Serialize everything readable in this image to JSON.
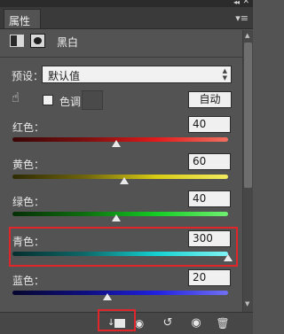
{
  "panel": {
    "tab_label": "属性",
    "collapse_glyph": "◂◂",
    "close_glyph": "✕",
    "menu_glyph": "▾≡"
  },
  "header": {
    "adjustment_title": "黑白",
    "adjustment_icon": "black-white-adjustment-icon",
    "mask_icon": "layer-mask-icon"
  },
  "preset": {
    "label": "预设：",
    "value": "默认值"
  },
  "controls": {
    "tint_label": "色调",
    "tint_checked": false,
    "auto_label": "自动",
    "hand_icon": "targeted-adjustment-hand-icon"
  },
  "sliders": [
    {
      "label": "红色：",
      "value": "40",
      "min": -200,
      "max": 300,
      "colors": [
        "#3a0606",
        "#7a1010",
        "#e11a1a",
        "#f07060"
      ]
    },
    {
      "label": "黄色：",
      "value": "60",
      "min": -200,
      "max": 300,
      "colors": [
        "#2e2a04",
        "#6e640c",
        "#d8cc14",
        "#f2ea60"
      ]
    },
    {
      "label": "绿色：",
      "value": "40",
      "min": -200,
      "max": 300,
      "colors": [
        "#062e06",
        "#0e6e10",
        "#14cc24",
        "#70f070"
      ]
    },
    {
      "label": "青色：",
      "value": "300",
      "min": -200,
      "max": 300,
      "colors": [
        "#062e2e",
        "#0e6868",
        "#14d0d0",
        "#80f4f4"
      ]
    },
    {
      "label": "蓝色：",
      "value": "20",
      "min": -200,
      "max": 300,
      "colors": [
        "#06062e",
        "#0e0e7e",
        "#2020e0",
        "#7070f2"
      ]
    }
  ],
  "highlight": {
    "color": "#e0262b"
  },
  "bottom_bar": {
    "icons": [
      "clip-to-layer-icon",
      "view-previous-state-icon",
      "reset-adjustment-icon",
      "toggle-visibility-icon",
      "delete-icon"
    ]
  }
}
